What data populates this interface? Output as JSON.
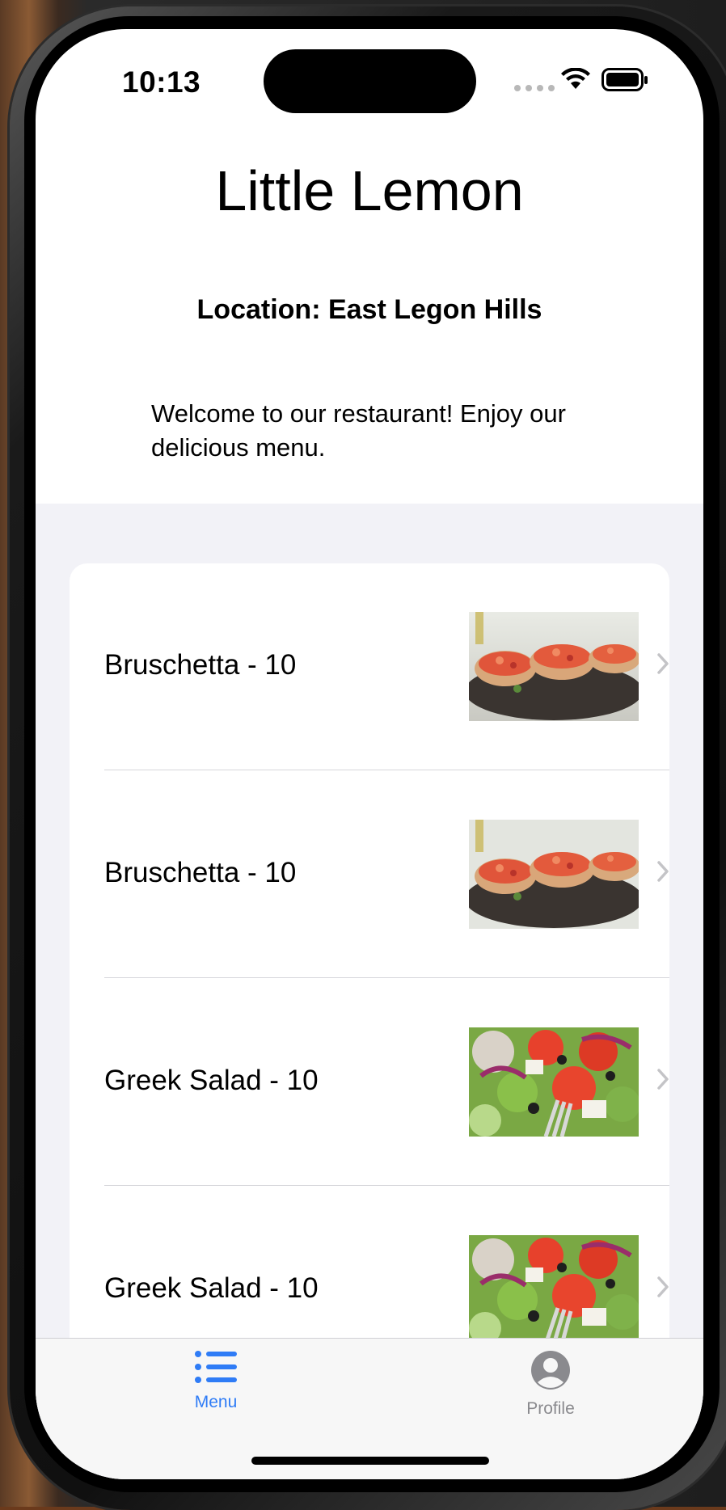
{
  "status_bar": {
    "time": "10:13"
  },
  "header": {
    "title": "Little Lemon",
    "location": "Location: East Legon Hills",
    "welcome": "Welcome to our restaurant! Enjoy our delicious menu."
  },
  "menu": {
    "items": [
      {
        "label": "Bruschetta - 10",
        "image": "bruschetta"
      },
      {
        "label": "Bruschetta - 10",
        "image": "bruschetta"
      },
      {
        "label": "Greek Salad - 10",
        "image": "greek-salad"
      },
      {
        "label": "Greek Salad - 10",
        "image": "greek-salad"
      }
    ]
  },
  "tabbar": {
    "tabs": [
      {
        "label": "Menu",
        "icon": "list-icon",
        "selected": true,
        "color": "#2f7cf6"
      },
      {
        "label": "Profile",
        "icon": "person-circle-icon",
        "selected": false,
        "color": "#8a8a8e"
      }
    ]
  }
}
